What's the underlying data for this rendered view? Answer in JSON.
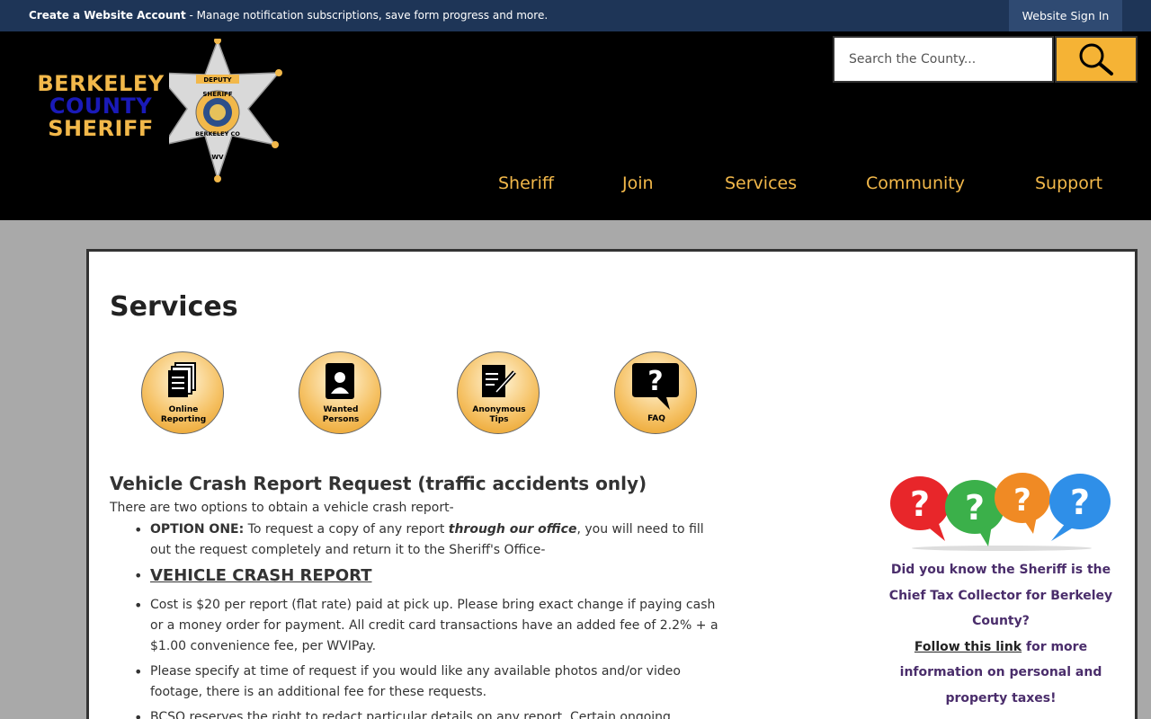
{
  "topbar": {
    "create_account_label": "Create a Website Account",
    "create_account_desc": " - Manage notification subscriptions, save form progress and more.",
    "sign_in_label": "Website Sign In"
  },
  "logo": {
    "line1": "BERKELEY",
    "line2": "COUNTY",
    "line3": "SHERIFF",
    "badge_text_top": "DEPUTY",
    "badge_text_mid": "SHERIFF",
    "badge_text_bottom": "BERKELEY CO",
    "badge_text_tip": "WV"
  },
  "search": {
    "placeholder": "Search the County...",
    "icon": "search-icon"
  },
  "nav": {
    "items": [
      "Sheriff",
      "Join",
      "Services",
      "Community",
      "Support"
    ]
  },
  "main": {
    "title": "Services",
    "quick_links": [
      {
        "label1": "Online",
        "label2": "Reporting",
        "icon": "documents-icon"
      },
      {
        "label1": "Wanted",
        "label2": "Persons",
        "icon": "person-icon"
      },
      {
        "label1": "Anonymous",
        "label2": "Tips",
        "icon": "pen-document-icon"
      },
      {
        "label1": "FAQ",
        "label2": "",
        "icon": "question-bubble-icon"
      }
    ],
    "section_title": "Vehicle Crash Report Request (traffic accidents only)",
    "intro": "There are two options to obtain a vehicle crash report-",
    "option_one_label": "OPTION ONE:",
    "option_one_text_a": " To request a copy of any report ",
    "option_one_emph": "through our office",
    "option_one_text_b": ", you will need to fill out the request completely and return it to the Sheriff's Office-",
    "crash_report_link": "VEHICLE CRASH REPORT",
    "bullet_cost": "Cost is $20 per report (flat rate) paid at pick up. Please bring exact change if paying cash or a money order for payment. All credit card transactions have an added fee of 2.2% + a $1.00 convenience fee, per WVIPay.",
    "bullet_photos": "Please specify at time of request if you would like any available photos and/or video footage, there is an additional fee for these requests.",
    "bullet_redact": "BCSO reserves the right to redact particular details on any report. Certain ongoing"
  },
  "sidebar": {
    "text_a": "Did you know the Sheriff is the Chief Tax Collector for Berkeley County?",
    "link": "Follow this link",
    "text_b": " for more information on personal and property taxes!",
    "colors": {
      "red": "#e8262a",
      "green": "#3bb04a",
      "orange": "#f08a24",
      "blue": "#2f8fe8"
    }
  }
}
